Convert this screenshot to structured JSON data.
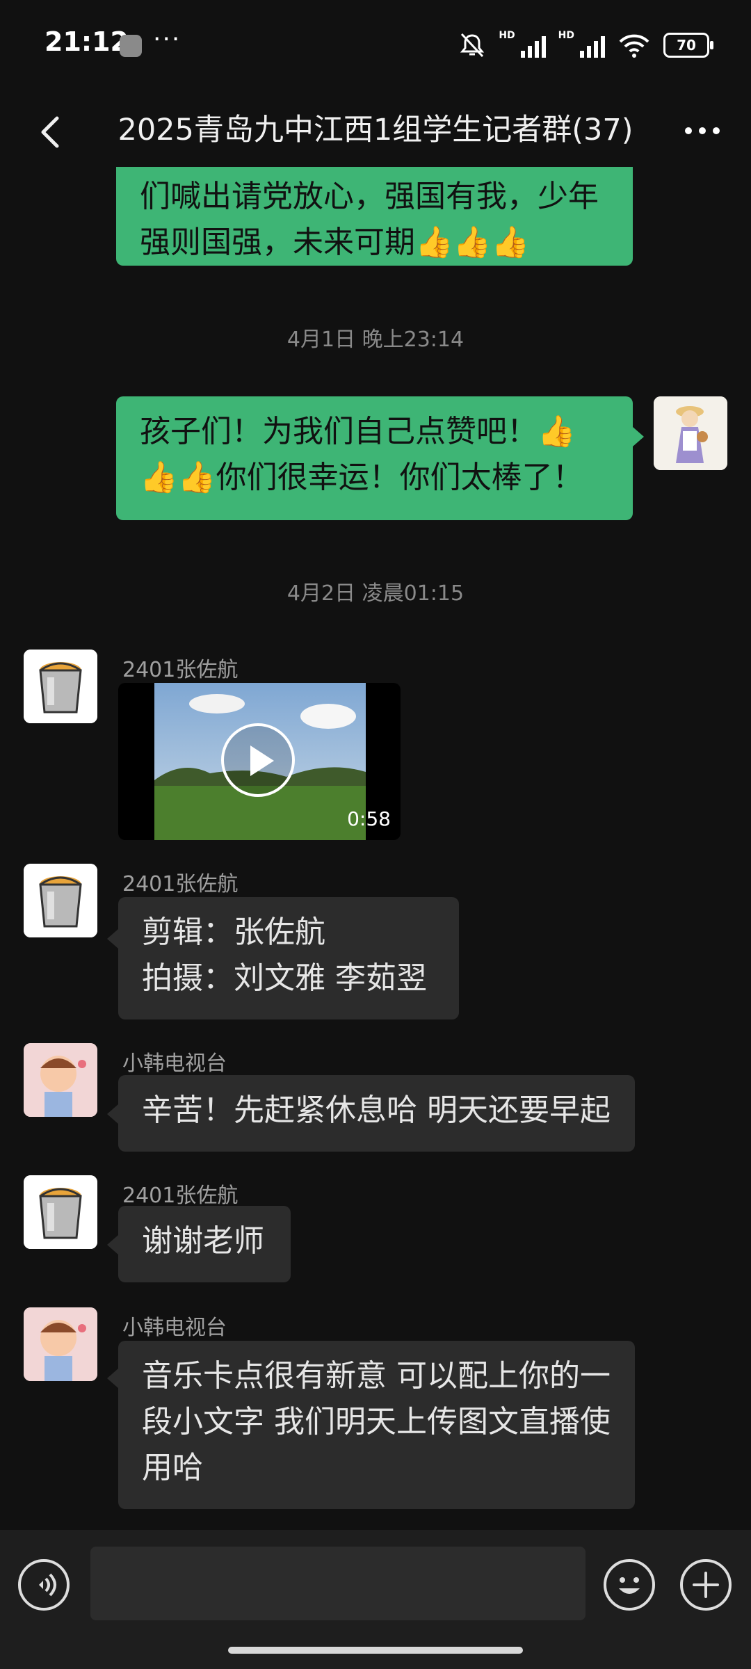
{
  "status_bar": {
    "time": "21:12",
    "overflow": "···",
    "hd1": "HD",
    "hd2": "HD",
    "battery": "70",
    "icons": [
      "app-notification-icon",
      "mute-bell-icon",
      "signal-icon",
      "wifi-icon",
      "battery-icon"
    ]
  },
  "header": {
    "title": "2025青岛九中江西1组学生记者群(37)",
    "back_icon": "back-arrow-icon",
    "more_icon": "more-dots-icon"
  },
  "messages": {
    "m1": {
      "side": "right",
      "lines": [
        "们喊出请党放心，强国有我，少年",
        "强则国强，未来可期👍👍👍"
      ]
    },
    "sep1": "4月1日 晚上23:14",
    "m2": {
      "side": "right",
      "lines": [
        "孩子们！为我们自己点赞吧！👍",
        "👍👍你们很幸运！你们太棒了！"
      ]
    },
    "sep2": "4月2日 凌晨01:15",
    "m3": {
      "sender": "2401张佐航",
      "type": "video",
      "duration": "0:58"
    },
    "m4": {
      "sender": "2401张佐航",
      "lines": [
        "剪辑：张佐航",
        "拍摄：刘文雅 李茹翌"
      ]
    },
    "m5": {
      "sender": "小韩电视台",
      "lines": [
        "辛苦！先赶紧休息哈 明天还要早起"
      ]
    },
    "m6": {
      "sender": "2401张佐航",
      "lines": [
        "谢谢老师"
      ]
    },
    "m7": {
      "sender": "小韩电视台",
      "lines": [
        "音乐卡点很有新意 可以配上你的一",
        "段小文字 我们明天上传图文直播使",
        "用哈"
      ]
    }
  },
  "input_bar": {
    "input_value": "",
    "icons": [
      "voice-icon",
      "emoji-icon",
      "plus-icon"
    ]
  },
  "colors": {
    "background": "#111111",
    "self_bubble": "#3eb575",
    "other_bubble": "#2c2c2c"
  }
}
